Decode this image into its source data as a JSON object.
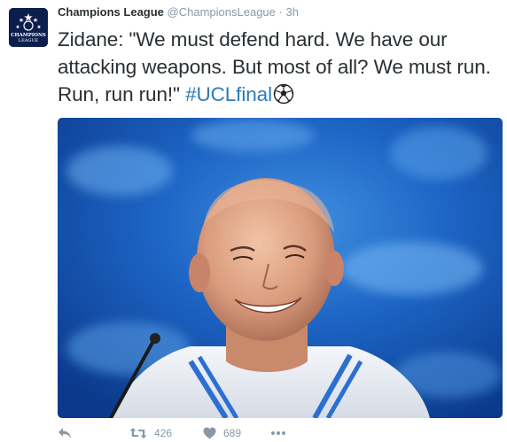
{
  "author": {
    "name": "Champions League",
    "handle": "@ChampionsLeague",
    "separator": "·",
    "time": "3h",
    "avatar_text": "CHAMPIONS LEAGUE"
  },
  "tweet": {
    "text": "Zidane: \"We must defend hard. We have our attacking weapons. But most of all? We must run. Run, run run!\" ",
    "hashtag": "#UCLfinal",
    "emoji": "soccer-ball-icon"
  },
  "media": {
    "description_icon": "photo"
  },
  "actions": {
    "reply_icon": "reply-icon",
    "retweet_count": "426",
    "like_count": "689",
    "more_icon": "more-icon"
  },
  "colors": {
    "text": "#292f33",
    "muted": "#8899a6",
    "link": "#2b7bb9",
    "avatar_bg": "#0b1e4d"
  }
}
